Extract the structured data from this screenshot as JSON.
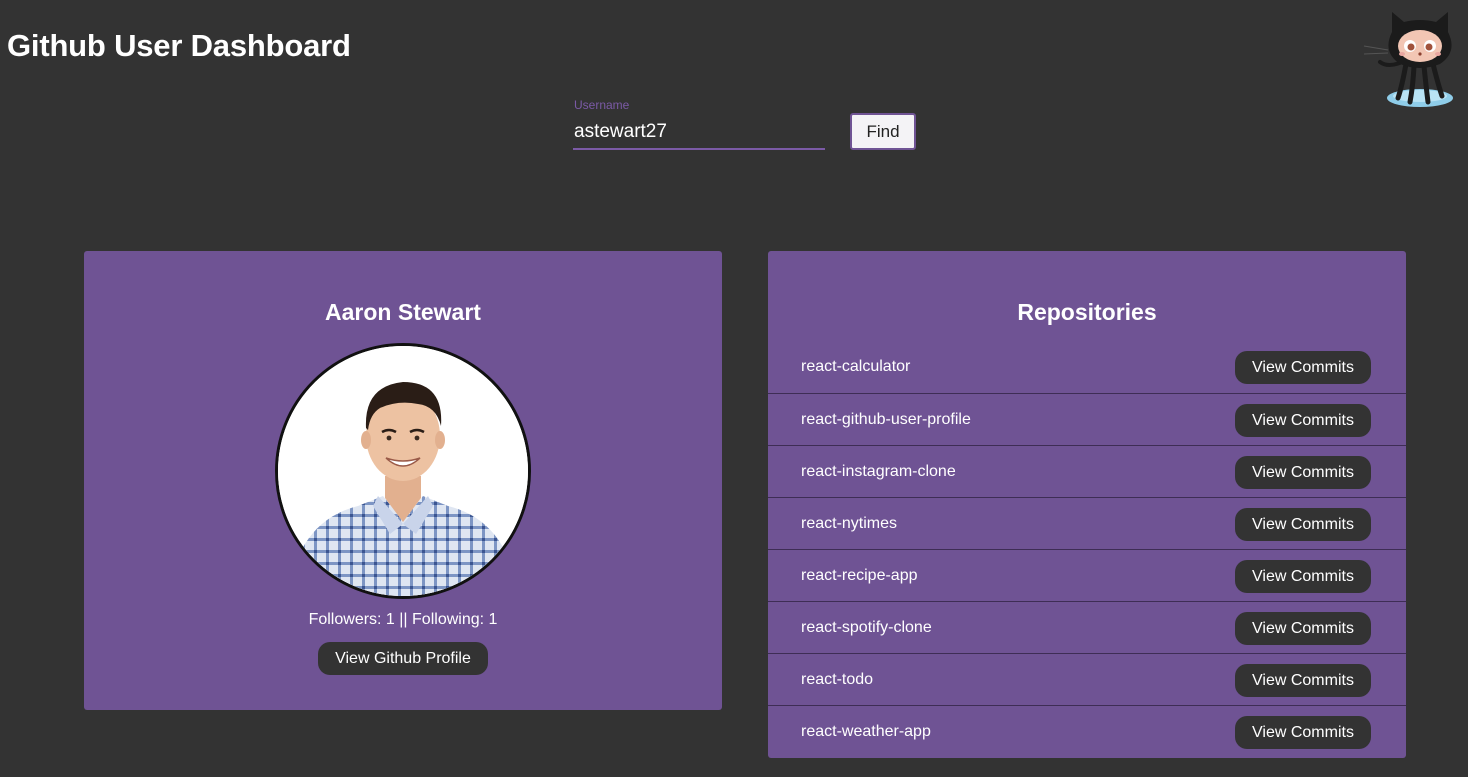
{
  "header": {
    "title": "Github User Dashboard"
  },
  "search": {
    "label": "Username",
    "value": "astewart27",
    "button_label": "Find"
  },
  "profile": {
    "name": "Aaron Stewart",
    "stats": "Followers: 1 || Following: 1",
    "button_label": "View Github Profile"
  },
  "repos": {
    "title": "Repositories",
    "button_label": "View Commits",
    "items": [
      "react-calculator",
      "react-github-user-profile",
      "react-instagram-clone",
      "react-nytimes",
      "react-recipe-app",
      "react-spotify-clone",
      "react-todo",
      "react-weather-app"
    ]
  },
  "colors": {
    "background": "#333333",
    "card": "#6f5394",
    "accent": "#7b5aa6",
    "button_dark": "#333333"
  },
  "icons": {
    "logo": "octocat-icon"
  }
}
